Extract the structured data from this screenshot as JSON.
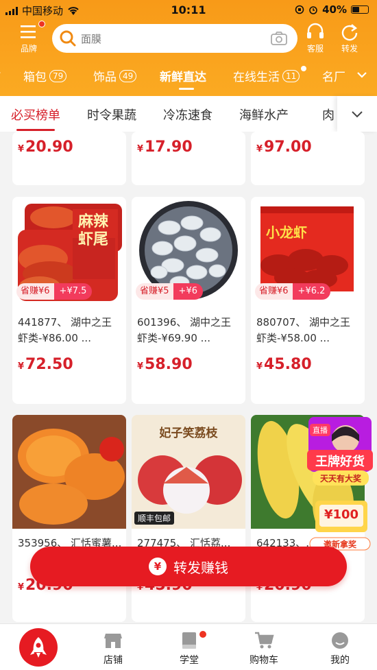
{
  "status": {
    "carrier": "中国移动",
    "time": "10:11",
    "battery": "40%"
  },
  "header": {
    "brand_label": "品牌",
    "service_label": "客服",
    "share_label": "转发",
    "search_placeholder": "面膜"
  },
  "categories": [
    {
      "label": "箱包",
      "count": "79"
    },
    {
      "label": "饰品",
      "count": "49"
    },
    {
      "label": "新鲜直达",
      "count": ""
    },
    {
      "label": "在线生活",
      "count": "11"
    },
    {
      "label": "名厂",
      "count": ""
    }
  ],
  "subtabs": [
    "必买榜单",
    "时令果蔬",
    "冷冻速食",
    "海鲜水产",
    "肉"
  ],
  "row1_prices": [
    "20.90",
    "17.90",
    "97.00"
  ],
  "products": [
    {
      "save": "省赚¥6",
      "plus": "+¥7.5",
      "desc": "441877、 湖中之王虾类-¥86.00 ...",
      "price": "72.50",
      "pkg_text": "麻辣虾尾"
    },
    {
      "save": "省赚¥5",
      "plus": "+¥6",
      "desc": "601396、 湖中之王虾类-¥69.90 ...",
      "price": "58.90"
    },
    {
      "save": "省赚¥6",
      "plus": "+¥6.2",
      "desc": "880707、 湖中之王虾类-¥58.00 ...",
      "price": "45.80",
      "pkg_text": "小龙虾"
    }
  ],
  "row3": [
    {
      "desc": "353956、 汇恬蜜薯...",
      "price": "20.90"
    },
    {
      "desc": "277475、 汇恬荔...",
      "price": "45.90",
      "banner": "妃子笑荔枝",
      "badge": "顺丰包邮"
    },
    {
      "desc": "642133、...",
      "price": "20.90"
    }
  ],
  "live": {
    "tag": "直播",
    "title": "王牌好货",
    "subtitle": "天天有大奖",
    "amount": "100",
    "invite": "邀新拿奖"
  },
  "share_button": "转发赚钱",
  "tabbar": [
    "店铺",
    "学堂",
    "购物车",
    "我的"
  ]
}
